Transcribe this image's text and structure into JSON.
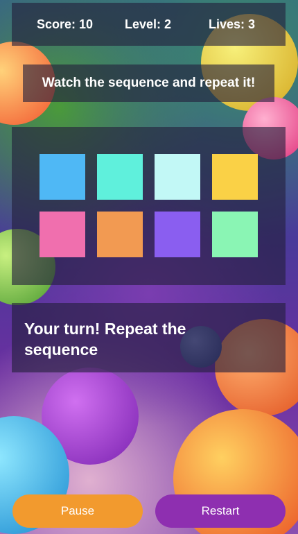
{
  "hud": {
    "score_text": "Score: 10",
    "level_text": "Level: 2",
    "lives_text": "Lives: 3"
  },
  "instruction": "Watch the sequence and repeat it!",
  "tiles": [
    {
      "name": "tile-blue",
      "color": "#4fb8f5"
    },
    {
      "name": "tile-cyan",
      "color": "#5ff0dc"
    },
    {
      "name": "tile-light-cyan",
      "color": "#c2f8f6"
    },
    {
      "name": "tile-yellow",
      "color": "#fad146"
    },
    {
      "name": "tile-pink",
      "color": "#f06fae"
    },
    {
      "name": "tile-orange",
      "color": "#f29a52"
    },
    {
      "name": "tile-purple",
      "color": "#8a5ef0"
    },
    {
      "name": "tile-mint",
      "color": "#8af5b4"
    }
  ],
  "message": "Your turn! Repeat the sequence",
  "buttons": {
    "pause_label": "Pause",
    "restart_label": "Restart",
    "pause_color": "#f29a2e",
    "restart_color": "#8e2fb0"
  }
}
